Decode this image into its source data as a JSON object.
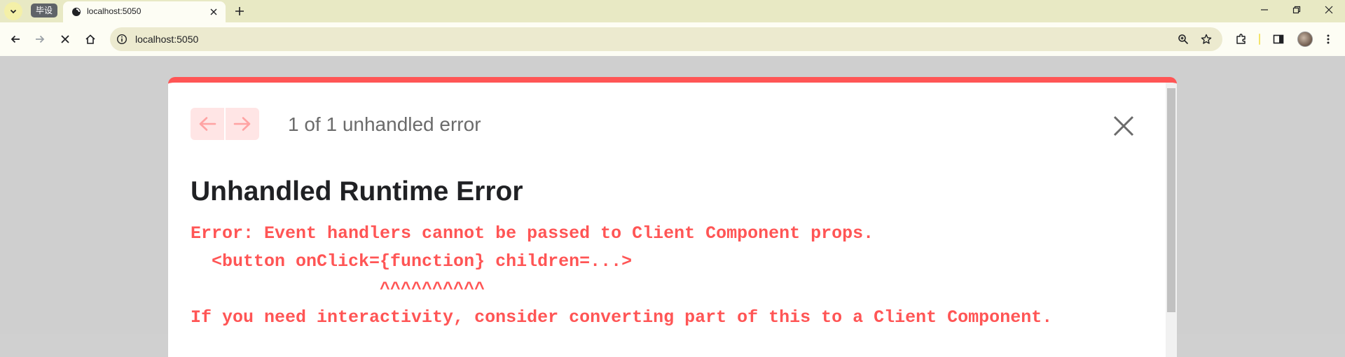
{
  "browser": {
    "group_label": "毕设",
    "tab": {
      "title": "localhost:5050"
    },
    "omnibox": {
      "url": "localhost:5050"
    }
  },
  "error_overlay": {
    "count_text": "1 of 1 unhandled error",
    "title": "Unhandled Runtime Error",
    "message_lines": [
      "Error: Event handlers cannot be passed to Client Component props.",
      "  <button onClick={function} children=...>",
      "                  ^^^^^^^^^^",
      "If you need interactivity, consider converting part of this to a Client Component."
    ]
  },
  "colors": {
    "accent_red": "#ff5555",
    "pager_bg": "#ffe5e5",
    "tabbar_bg": "#e8e9c4",
    "toolbar_bg": "#fdfdf4"
  }
}
